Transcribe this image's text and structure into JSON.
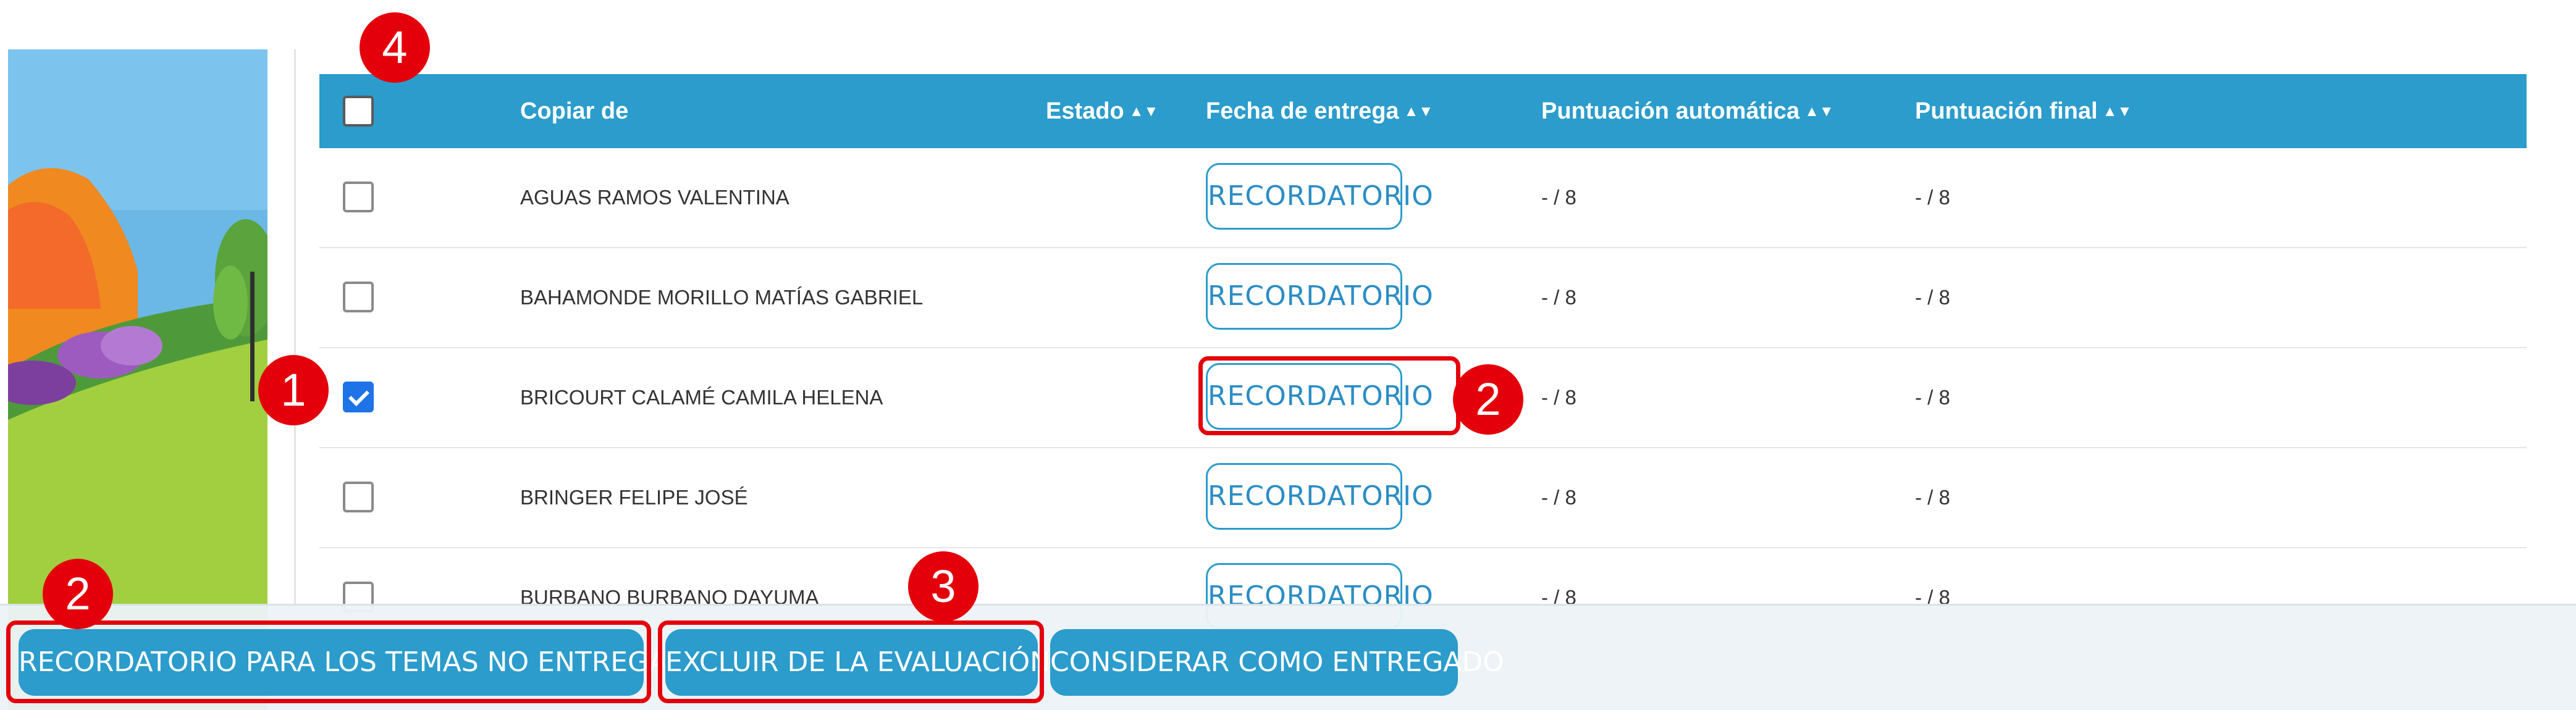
{
  "table": {
    "headers": {
      "copy_of": "Copiar de",
      "status": "Estado",
      "due_date": "Fecha de entrega",
      "auto_score": "Puntuación automática",
      "final_score": "Puntuación final"
    },
    "sort_glyph": "▲▼",
    "rows": [
      {
        "name": "AGUAS RAMOS VALENTINA",
        "reminder": "RECORDATORIO",
        "auto": "- / 8",
        "final": "- / 8",
        "checked": false
      },
      {
        "name": "BAHAMONDE MORILLO MATÍAS GABRIEL",
        "reminder": "RECORDATORIO",
        "auto": "- / 8",
        "final": "- / 8",
        "checked": false
      },
      {
        "name": "BRICOURT CALAMÉ CAMILA HELENA",
        "reminder": "RECORDATORIO",
        "auto": "- / 8",
        "final": "- / 8",
        "checked": true
      },
      {
        "name": "BRINGER FELIPE JOSÉ",
        "reminder": "RECORDATORIO",
        "auto": "- / 8",
        "final": "- / 8",
        "checked": false
      },
      {
        "name": "BURBANO BURBANO DAYUMA",
        "reminder": "RECORDATORIO",
        "auto": "- / 8",
        "final": "- / 8",
        "checked": false
      }
    ]
  },
  "actions": {
    "remind_all": "RECORDATORIO PARA LOS TEMAS NO ENTREGADOS",
    "exclude": "EXCLUIR DE LA EVALUACIÓN",
    "mark_delivered": "CONSIDERAR COMO ENTREGADO"
  },
  "annotations": {
    "m1": "1",
    "m2a": "2",
    "m2b": "2",
    "m3": "3",
    "m4": "4"
  },
  "colors": {
    "header_bg": "#2b9ccb",
    "button_bg": "#2b9ccb",
    "annotation_red": "#e4000b",
    "checkbox_checked": "#1e73e6"
  }
}
